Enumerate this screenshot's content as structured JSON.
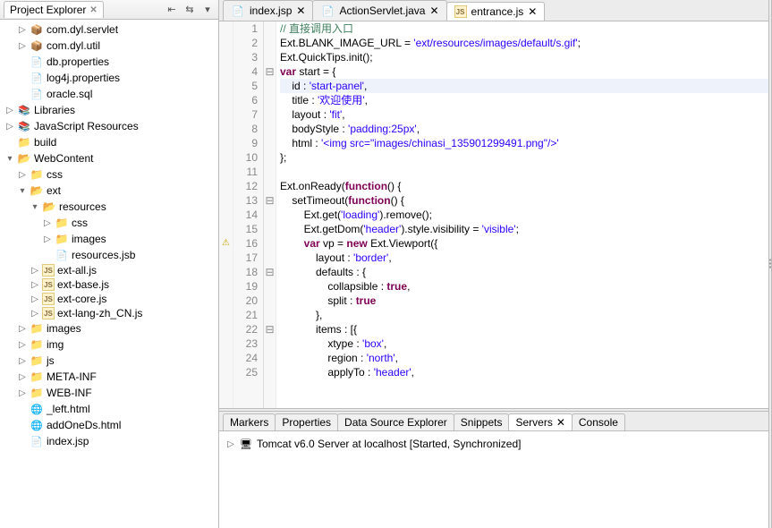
{
  "explorer": {
    "title": "Project Explorer",
    "items": [
      {
        "indent": 1,
        "exp": "▷",
        "icon": "package-icon",
        "label": "com.dyl.servlet"
      },
      {
        "indent": 1,
        "exp": "▷",
        "icon": "package-icon",
        "label": "com.dyl.util"
      },
      {
        "indent": 1,
        "exp": "",
        "icon": "file-icon",
        "label": "db.properties"
      },
      {
        "indent": 1,
        "exp": "",
        "icon": "file-icon",
        "label": "log4j.properties"
      },
      {
        "indent": 1,
        "exp": "",
        "icon": "file-icon",
        "label": "oracle.sql"
      },
      {
        "indent": 0,
        "exp": "▷",
        "icon": "lib-icon",
        "label": "Libraries"
      },
      {
        "indent": 0,
        "exp": "▷",
        "icon": "lib-icon",
        "label": "JavaScript Resources"
      },
      {
        "indent": 0,
        "exp": "",
        "icon": "folder-icon",
        "label": "build"
      },
      {
        "indent": 0,
        "exp": "▾",
        "icon": "folder-open-icon",
        "label": "WebContent"
      },
      {
        "indent": 1,
        "exp": "▷",
        "icon": "folder-icon",
        "label": "css"
      },
      {
        "indent": 1,
        "exp": "▾",
        "icon": "folder-open-icon",
        "label": "ext"
      },
      {
        "indent": 2,
        "exp": "▾",
        "icon": "folder-open-icon",
        "label": "resources"
      },
      {
        "indent": 3,
        "exp": "▷",
        "icon": "folder-icon",
        "label": "css"
      },
      {
        "indent": 3,
        "exp": "▷",
        "icon": "folder-icon",
        "label": "images"
      },
      {
        "indent": 3,
        "exp": "",
        "icon": "file-icon",
        "label": "resources.jsb"
      },
      {
        "indent": 2,
        "exp": "▷",
        "icon": "js-icon",
        "label": "ext-all.js"
      },
      {
        "indent": 2,
        "exp": "▷",
        "icon": "js-icon",
        "label": "ext-base.js"
      },
      {
        "indent": 2,
        "exp": "▷",
        "icon": "js-icon",
        "label": "ext-core.js"
      },
      {
        "indent": 2,
        "exp": "▷",
        "icon": "js-icon",
        "label": "ext-lang-zh_CN.js"
      },
      {
        "indent": 1,
        "exp": "▷",
        "icon": "folder-icon",
        "label": "images"
      },
      {
        "indent": 1,
        "exp": "▷",
        "icon": "folder-icon",
        "label": "img"
      },
      {
        "indent": 1,
        "exp": "▷",
        "icon": "folder-icon",
        "label": "js"
      },
      {
        "indent": 1,
        "exp": "▷",
        "icon": "folder-icon",
        "label": "META-INF"
      },
      {
        "indent": 1,
        "exp": "▷",
        "icon": "folder-icon",
        "label": "WEB-INF"
      },
      {
        "indent": 1,
        "exp": "",
        "icon": "html-icon",
        "label": "_left.html"
      },
      {
        "indent": 1,
        "exp": "",
        "icon": "html-icon",
        "label": "addOneDs.html"
      },
      {
        "indent": 1,
        "exp": "",
        "icon": "file-icon",
        "label": "index.jsp"
      }
    ]
  },
  "editor_tabs": [
    {
      "label": "index.jsp",
      "icon": "file-icon",
      "active": false
    },
    {
      "label": "ActionServlet.java",
      "icon": "file-icon",
      "active": false
    },
    {
      "label": "entrance.js",
      "icon": "js-icon",
      "active": true
    }
  ],
  "code": {
    "start_line": 1,
    "current_line": 5,
    "folds": {
      "4": "⊟",
      "10": "",
      "13": "⊟",
      "18": "⊟",
      "21": "",
      "22": "⊟"
    },
    "marks": {
      "16": "warn"
    },
    "lines": [
      {
        "n": 1,
        "html": "<span class='cmt'>// 直接调用入口</span>"
      },
      {
        "n": 2,
        "html": "Ext.BLANK_IMAGE_URL = <span class='str'>'ext/resources/images/default/s.gif'</span>;"
      },
      {
        "n": 3,
        "html": "Ext.QuickTips.init();"
      },
      {
        "n": 4,
        "html": "<span class='kw'>var</span> start = {"
      },
      {
        "n": 5,
        "html": "    id : <span class='str'>'start-panel'</span>,"
      },
      {
        "n": 6,
        "html": "    title : <span class='str'>'欢迎使用'</span>,"
      },
      {
        "n": 7,
        "html": "    layout : <span class='str'>'fit'</span>,"
      },
      {
        "n": 8,
        "html": "    bodyStyle : <span class='str'>'padding:25px'</span>,"
      },
      {
        "n": 9,
        "html": "    html : <span class='str'>'&lt;img src=\"images/chinasi_135901299491.png\"/&gt;'</span>"
      },
      {
        "n": 10,
        "html": "};"
      },
      {
        "n": 11,
        "html": ""
      },
      {
        "n": 12,
        "html": "Ext.onReady(<span class='kw'>function</span>() {"
      },
      {
        "n": 13,
        "html": "    setTimeout(<span class='kw'>function</span>() {"
      },
      {
        "n": 14,
        "html": "        Ext.get(<span class='str'>'loading'</span>).remove();"
      },
      {
        "n": 15,
        "html": "        Ext.getDom(<span class='str'>'header'</span>).style.visibility = <span class='str'>'visible'</span>;"
      },
      {
        "n": 16,
        "html": "        <span class='kw'>var</span> vp = <span class='kw'>new</span> Ext.Viewport({"
      },
      {
        "n": 17,
        "html": "            layout : <span class='str'>'border'</span>,"
      },
      {
        "n": 18,
        "html": "            defaults : {"
      },
      {
        "n": 19,
        "html": "                collapsible : <span class='kw'>true</span>,"
      },
      {
        "n": 20,
        "html": "                split : <span class='kw'>true</span>"
      },
      {
        "n": 21,
        "html": "            },"
      },
      {
        "n": 22,
        "html": "            items : [{"
      },
      {
        "n": 23,
        "html": "                xtype : <span class='str'>'box'</span>,"
      },
      {
        "n": 24,
        "html": "                region : <span class='str'>'north'</span>,"
      },
      {
        "n": 25,
        "html": "                applyTo : <span class='str'>'header'</span>,"
      }
    ]
  },
  "bottom_tabs": [
    {
      "label": "Markers",
      "active": false
    },
    {
      "label": "Properties",
      "active": false
    },
    {
      "label": "Data Source Explorer",
      "active": false
    },
    {
      "label": "Snippets",
      "active": false
    },
    {
      "label": "Servers",
      "active": true
    },
    {
      "label": "Console",
      "active": false
    }
  ],
  "servers": {
    "row": "Tomcat v6.0 Server at localhost  [Started, Synchronized]"
  }
}
